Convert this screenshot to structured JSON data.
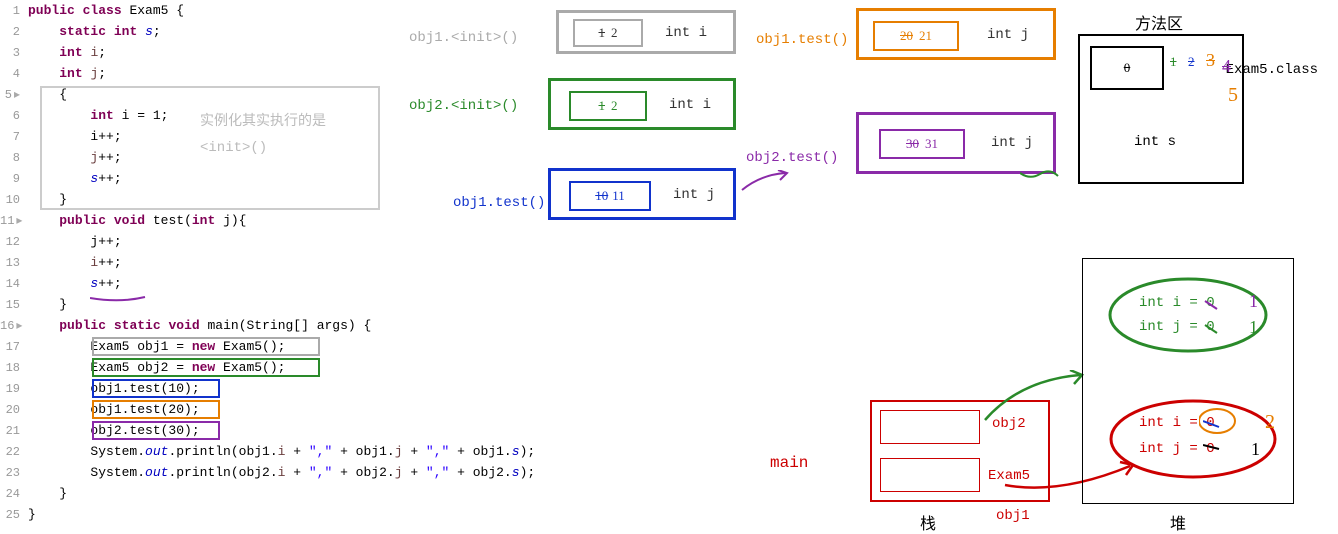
{
  "code": {
    "lines": [
      {
        "n": "1",
        "t": "public class Exam5 {",
        "kw": [
          "public",
          "class"
        ]
      },
      {
        "n": "2",
        "t": "    static int s;",
        "kw": [
          "static",
          "int"
        ]
      },
      {
        "n": "3",
        "t": "    int i;",
        "kw": [
          "int"
        ]
      },
      {
        "n": "4",
        "t": "    int j;",
        "kw": [
          "int"
        ]
      },
      {
        "n": "5",
        "t": "    {"
      },
      {
        "n": "6",
        "t": "        int i = 1;",
        "kw": [
          "int"
        ]
      },
      {
        "n": "7",
        "t": "        i++;"
      },
      {
        "n": "8",
        "t": "        j++;"
      },
      {
        "n": "9",
        "t": "        s++;"
      },
      {
        "n": "10",
        "t": "    }"
      },
      {
        "n": "11",
        "t": "    public void test(int j){",
        "kw": [
          "public",
          "void",
          "int"
        ]
      },
      {
        "n": "12",
        "t": "        j++;"
      },
      {
        "n": "13",
        "t": "        i++;"
      },
      {
        "n": "14",
        "t": "        s++;"
      },
      {
        "n": "15",
        "t": "    }"
      },
      {
        "n": "16",
        "t": "    public static void main(String[] args) {",
        "kw": [
          "public",
          "static",
          "void"
        ]
      },
      {
        "n": "17",
        "t": "        Exam5 obj1 = new Exam5();",
        "kw": [
          "new"
        ]
      },
      {
        "n": "18",
        "t": "        Exam5 obj2 = new Exam5();",
        "kw": [
          "new"
        ]
      },
      {
        "n": "19",
        "t": "        obj1.test(10);"
      },
      {
        "n": "20",
        "t": "        obj1.test(20);"
      },
      {
        "n": "21",
        "t": "        obj2.test(30);"
      },
      {
        "n": "22",
        "t": "        System.out.println(obj1.i + \",\" + obj1.j + \",\" + obj1.s);"
      },
      {
        "n": "23",
        "t": "        System.out.println(obj2.i + \",\" + obj2.j + \",\" + obj2.s);"
      },
      {
        "n": "24",
        "t": "    }"
      },
      {
        "n": "25",
        "t": "}"
      }
    ]
  },
  "comment": {
    "l1": "实例化其实执行的是",
    "l2": "<init>()"
  },
  "frames": {
    "obj1_init": {
      "call": "obj1.<init>()",
      "var": "int i",
      "val_old": "1",
      "val_new": "2",
      "color": "#aaa"
    },
    "obj2_init": {
      "call": "obj2.<init>()",
      "var": "int i",
      "val_old": "1",
      "val_new": "2",
      "color": "#2a8a2a"
    },
    "obj1_test10": {
      "call": "obj1.test()",
      "var": "int j",
      "val_old": "10",
      "val_new": "11",
      "color": "#1133cc"
    },
    "obj1_test20": {
      "call": "obj1.test()",
      "var": "int j",
      "val_old": "20",
      "val_new": "21",
      "color": "#e67e00"
    },
    "obj2_test30": {
      "call": "obj2.test()",
      "var": "int j",
      "val_old": "30",
      "val_new": "31",
      "color": "#8a2aa8"
    }
  },
  "method_area": {
    "title": "方法区",
    "class": "Exam5.class",
    "static": "int s",
    "seq": [
      "0",
      "1",
      "2",
      "3",
      "4",
      "5"
    ]
  },
  "stack": {
    "title": "栈",
    "label": "main",
    "obj2": "obj2",
    "obj1": "obj1",
    "exam5": "Exam5"
  },
  "heap": {
    "title": "堆",
    "obj2": {
      "i": "int i = 0",
      "j": "int j = 0",
      "i_new": "1",
      "j_new": "1"
    },
    "obj1": {
      "i": "int i = 0",
      "j": "int j = 0",
      "i_new": "2",
      "j_new": "1"
    }
  }
}
